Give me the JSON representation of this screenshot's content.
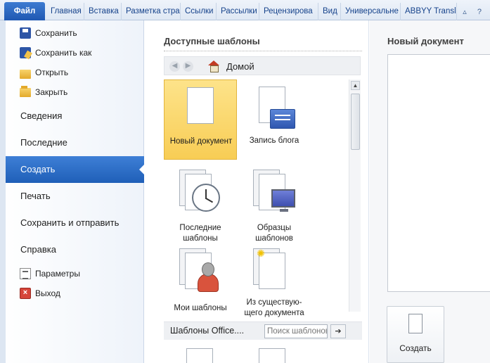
{
  "ribbon": {
    "file_tab": "Файл",
    "tabs": [
      "Главная",
      "Вставка",
      "Разметка стра",
      "Ссылки",
      "Рассылки",
      "Рецензирова",
      "Вид",
      "Универсальне",
      "ABBYY Translat"
    ],
    "window_controls": "▵ ?"
  },
  "backstage_nav": {
    "commands_top": [
      {
        "label": "Сохранить",
        "icon": "save-icon"
      },
      {
        "label": "Сохранить как",
        "icon": "save-as-icon"
      },
      {
        "label": "Открыть",
        "icon": "open-folder-icon"
      },
      {
        "label": "Закрыть",
        "icon": "close-folder-icon"
      }
    ],
    "tabs": [
      "Сведения",
      "Последние",
      "Создать",
      "Печать",
      "Сохранить и отправить",
      "Справка"
    ],
    "active_tab": "Создать",
    "commands_bottom": [
      {
        "label": "Параметры",
        "icon": "options-icon"
      },
      {
        "label": "Выход",
        "icon": "exit-icon"
      }
    ]
  },
  "templates": {
    "title": "Доступные шаблоны",
    "breadcrumb_home": "Домой",
    "items": [
      {
        "label_line1": "Новый документ",
        "label_line2": "",
        "icon": "blank-document-icon"
      },
      {
        "label_line1": "Запись блога",
        "label_line2": "",
        "icon": "blog-post-icon"
      },
      {
        "label_line1": "Последние",
        "label_line2": "шаблоны",
        "icon": "recent-templates-icon"
      },
      {
        "label_line1": "Образцы",
        "label_line2": "шаблонов",
        "icon": "sample-templates-icon"
      },
      {
        "label_line1": "Мои шаблоны",
        "label_line2": "",
        "icon": "my-templates-icon"
      },
      {
        "label_line1": "Из существую-",
        "label_line2": "щего документа",
        "icon": "new-from-existing-icon"
      }
    ],
    "office_section": "Шаблоны Office....",
    "search_placeholder": "Поиск шаблонов"
  },
  "preview": {
    "title": "Новый документ",
    "create_label": "Создать"
  }
}
